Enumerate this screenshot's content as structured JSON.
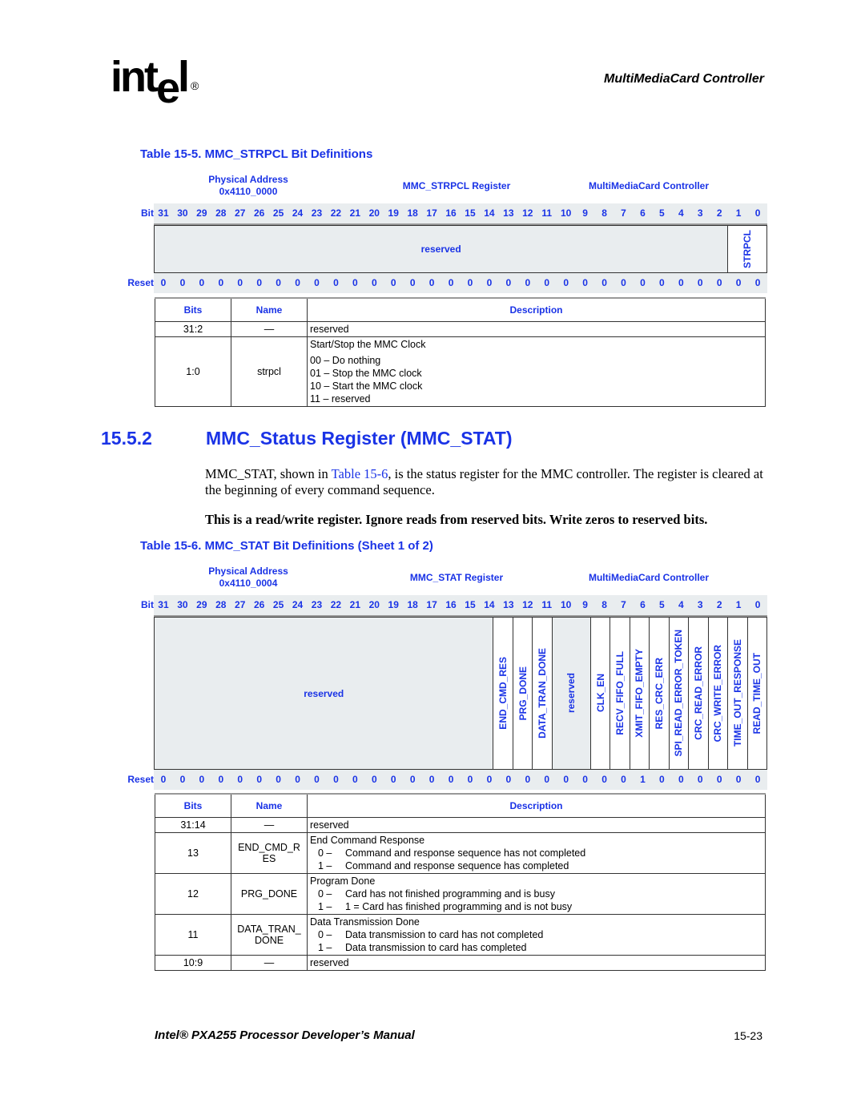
{
  "header": {
    "logo_text": "int",
    "logo_e": "e",
    "logo_l": "l",
    "logo_reg": "®",
    "section": "MultiMediaCard Controller"
  },
  "table_15_5": {
    "title": "Table 15-5. MMC_STRPCL Bit Definitions",
    "physical_address_label": "Physical Address",
    "physical_address": "0x4110_0000",
    "register_name": "MMC_STRPCL Register",
    "controller": "MultiMediaCard Controller",
    "bit_label": "Bit",
    "reset_label": "Reset",
    "bits": [
      "31",
      "30",
      "29",
      "28",
      "27",
      "26",
      "25",
      "24",
      "23",
      "22",
      "21",
      "20",
      "19",
      "18",
      "17",
      "16",
      "15",
      "14",
      "13",
      "12",
      "11",
      "10",
      "9",
      "8",
      "7",
      "6",
      "5",
      "4",
      "3",
      "2",
      "1",
      "0"
    ],
    "reset": [
      "0",
      "0",
      "0",
      "0",
      "0",
      "0",
      "0",
      "0",
      "0",
      "0",
      "0",
      "0",
      "0",
      "0",
      "0",
      "0",
      "0",
      "0",
      "0",
      "0",
      "0",
      "0",
      "0",
      "0",
      "0",
      "0",
      "0",
      "0",
      "0",
      "0",
      "0",
      "0"
    ],
    "fields": [
      {
        "label": "reserved",
        "span": 30,
        "reserved": true
      },
      {
        "label": "STRPCL",
        "span": 2,
        "reserved": false
      }
    ],
    "columns": [
      "Bits",
      "Name",
      "Description"
    ],
    "rows": [
      {
        "bits": "31:2",
        "name": "—",
        "desc": "reserved",
        "options": []
      },
      {
        "bits": "1:0",
        "name": "strpcl",
        "desc": "Start/Stop the MMC Clock",
        "options": [
          "00 – Do nothing",
          "01 – Stop the MMC clock",
          "10 – Start the MMC clock",
          "11 – reserved"
        ]
      }
    ]
  },
  "section": {
    "number": "15.5.2",
    "title": "MMC_Status Register (MMC_STAT)",
    "para1_pre": "MMC_STAT, shown in ",
    "para1_link": "Table 15-6",
    "para1_post": ", is the status register for the MMC controller. The register is cleared at the beginning of every command sequence.",
    "note": "This is a read/write register. Ignore reads from reserved bits. Write zeros to reserved bits."
  },
  "table_15_6": {
    "title": "Table 15-6. MMC_STAT Bit Definitions (Sheet 1 of 2)",
    "physical_address_label": "Physical Address",
    "physical_address": "0x4110_0004",
    "register_name": "MMC_STAT Register",
    "controller": "MultiMediaCard Controller",
    "bit_label": "Bit",
    "reset_label": "Reset",
    "bits": [
      "31",
      "30",
      "29",
      "28",
      "27",
      "26",
      "25",
      "24",
      "23",
      "22",
      "21",
      "20",
      "19",
      "18",
      "17",
      "16",
      "15",
      "14",
      "13",
      "12",
      "11",
      "10",
      "9",
      "8",
      "7",
      "6",
      "5",
      "4",
      "3",
      "2",
      "1",
      "0"
    ],
    "reset": [
      "0",
      "0",
      "0",
      "0",
      "0",
      "0",
      "0",
      "0",
      "0",
      "0",
      "0",
      "0",
      "0",
      "0",
      "0",
      "0",
      "0",
      "0",
      "0",
      "0",
      "0",
      "0",
      "0",
      "0",
      "0",
      "1",
      "0",
      "0",
      "0",
      "0",
      "0",
      "0"
    ],
    "fields": [
      {
        "label": "reserved",
        "span": 18,
        "reserved": true,
        "horizontal": true
      },
      {
        "label": "END_CMD_RES",
        "span": 1
      },
      {
        "label": "PRG_DONE",
        "span": 1
      },
      {
        "label": "DATA_TRAN_DONE",
        "span": 1
      },
      {
        "label": "reserved",
        "span": 2,
        "reserved": true
      },
      {
        "label": "CLK_EN",
        "span": 1
      },
      {
        "label": "RECV_FIFO_FULL",
        "span": 1
      },
      {
        "label": "XMIT_FIFO_EMPTY",
        "span": 1
      },
      {
        "label": "RES_CRC_ERR",
        "span": 1
      },
      {
        "label": "SPI_READ_ERROR_TOKEN",
        "span": 1
      },
      {
        "label": "CRC_READ_ERROR",
        "span": 1
      },
      {
        "label": "CRC_WRITE_ERROR",
        "span": 1
      },
      {
        "label": "TIME_OUT_RESPONSE",
        "span": 1
      },
      {
        "label": "READ_TIME_OUT",
        "span": 1
      }
    ],
    "columns": [
      "Bits",
      "Name",
      "Description"
    ],
    "rows": [
      {
        "bits": "31:14",
        "name": "—",
        "desc": "reserved",
        "options": []
      },
      {
        "bits": "13",
        "name": "END_CMD_R ES",
        "desc": "End Command Response",
        "options": [
          [
            "0 –",
            "Command and response sequence has not completed"
          ],
          [
            "1 –",
            "Command and response sequence has completed"
          ]
        ]
      },
      {
        "bits": "12",
        "name": "PRG_DONE",
        "desc": "Program Done",
        "options": [
          [
            "0 –",
            "Card has not finished programming and is busy"
          ],
          [
            "1 –",
            "1 = Card has finished programming and is not busy"
          ]
        ]
      },
      {
        "bits": "11",
        "name": "DATA_TRAN_ DONE",
        "desc": "Data Transmission Done",
        "options": [
          [
            "0 –",
            "Data transmission to card has not completed"
          ],
          [
            "1 –",
            "Data transmission to card has completed"
          ]
        ]
      },
      {
        "bits": "10:9",
        "name": "—",
        "desc": "reserved",
        "options": []
      }
    ]
  },
  "footer": {
    "title": "Intel® PXA255 Processor Developer’s Manual",
    "page": "15-23"
  }
}
